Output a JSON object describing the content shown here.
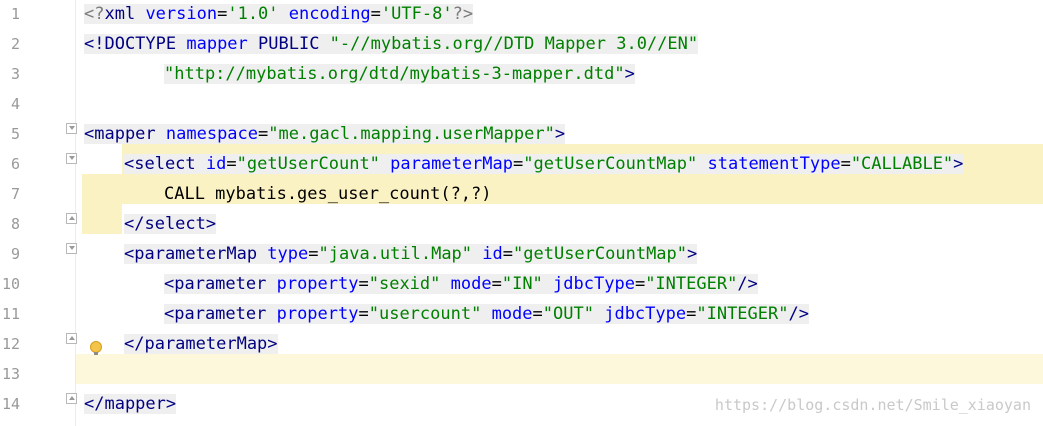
{
  "editor": {
    "lines": [
      {
        "num": "1",
        "segments": [
          {
            "t": "dim",
            "v": "<?"
          },
          {
            "t": "tag",
            "v": "xml "
          },
          {
            "t": "attr",
            "v": "version"
          },
          {
            "t": "txt",
            "v": "="
          },
          {
            "t": "val",
            "v": "'1.0'"
          },
          {
            "t": "txt",
            "v": " "
          },
          {
            "t": "attr",
            "v": "encoding"
          },
          {
            "t": "txt",
            "v": "="
          },
          {
            "t": "val",
            "v": "'UTF-8'"
          },
          {
            "t": "dim",
            "v": "?>"
          }
        ]
      },
      {
        "num": "2",
        "segments": [
          {
            "t": "tag",
            "v": "<!DOCTYPE "
          },
          {
            "t": "attr",
            "v": "mapper"
          },
          {
            "t": "tag",
            "v": " PUBLIC "
          },
          {
            "t": "val",
            "v": "\"-//mybatis.org//DTD Mapper 3.0//EN\""
          }
        ]
      },
      {
        "num": "3",
        "segments": [
          {
            "t": "val",
            "v": "\"http://mybatis.org/dtd/mybatis-3-mapper.dtd\""
          },
          {
            "t": "tag",
            "v": ">"
          }
        ]
      },
      {
        "num": "4",
        "segments": []
      },
      {
        "num": "5",
        "segments": [
          {
            "t": "tag",
            "v": "<mapper "
          },
          {
            "t": "attr",
            "v": "namespace"
          },
          {
            "t": "txt",
            "v": "="
          },
          {
            "t": "val",
            "v": "\"me.gacl.mapping.userMapper\""
          },
          {
            "t": "tag",
            "v": ">"
          }
        ]
      },
      {
        "num": "6",
        "segments": [
          {
            "t": "tag",
            "v": "<select "
          },
          {
            "t": "attr",
            "v": "id"
          },
          {
            "t": "txt",
            "v": "="
          },
          {
            "t": "val",
            "v": "\"getUserCount\""
          },
          {
            "t": "txt",
            "v": " "
          },
          {
            "t": "attr",
            "v": "parameterMap"
          },
          {
            "t": "txt",
            "v": "="
          },
          {
            "t": "val",
            "v": "\"getUserCountMap\""
          },
          {
            "t": "txt",
            "v": " "
          },
          {
            "t": "attr",
            "v": "statementType"
          },
          {
            "t": "txt",
            "v": "="
          },
          {
            "t": "val",
            "v": "\"CALLABLE\""
          },
          {
            "t": "tag",
            "v": ">"
          }
        ]
      },
      {
        "num": "7",
        "segments": [
          {
            "t": "txt",
            "v": "CALL mybatis.ges_user_count(?,?)"
          }
        ]
      },
      {
        "num": "8",
        "segments": [
          {
            "t": "tag",
            "v": "</select>"
          }
        ]
      },
      {
        "num": "9",
        "segments": [
          {
            "t": "tag",
            "v": "<parameterMap "
          },
          {
            "t": "attr",
            "v": "type"
          },
          {
            "t": "txt",
            "v": "="
          },
          {
            "t": "val",
            "v": "\"java.util.Map\""
          },
          {
            "t": "txt",
            "v": " "
          },
          {
            "t": "attr",
            "v": "id"
          },
          {
            "t": "txt",
            "v": "="
          },
          {
            "t": "val",
            "v": "\"getUserCountMap\""
          },
          {
            "t": "tag",
            "v": ">"
          }
        ]
      },
      {
        "num": "10",
        "segments": [
          {
            "t": "tag",
            "v": "<parameter "
          },
          {
            "t": "attr",
            "v": "property"
          },
          {
            "t": "txt",
            "v": "="
          },
          {
            "t": "val",
            "v": "\"sexid\""
          },
          {
            "t": "txt",
            "v": " "
          },
          {
            "t": "attr",
            "v": "mode"
          },
          {
            "t": "txt",
            "v": "="
          },
          {
            "t": "val",
            "v": "\"IN\""
          },
          {
            "t": "txt",
            "v": " "
          },
          {
            "t": "attr",
            "v": "jdbcType"
          },
          {
            "t": "txt",
            "v": "="
          },
          {
            "t": "val",
            "v": "\"INTEGER\""
          },
          {
            "t": "tag",
            "v": "/>"
          }
        ]
      },
      {
        "num": "11",
        "segments": [
          {
            "t": "tag",
            "v": "<parameter "
          },
          {
            "t": "attr",
            "v": "property"
          },
          {
            "t": "txt",
            "v": "="
          },
          {
            "t": "val",
            "v": "\"usercount\""
          },
          {
            "t": "txt",
            "v": " "
          },
          {
            "t": "attr",
            "v": "mode"
          },
          {
            "t": "txt",
            "v": "="
          },
          {
            "t": "val",
            "v": "\"OUT\""
          },
          {
            "t": "txt",
            "v": " "
          },
          {
            "t": "attr",
            "v": "jdbcType"
          },
          {
            "t": "txt",
            "v": "="
          },
          {
            "t": "val",
            "v": "\"INTEGER\""
          },
          {
            "t": "tag",
            "v": "/>"
          }
        ]
      },
      {
        "num": "12",
        "segments": [
          {
            "t": "tag",
            "v": "</parameterMap>"
          }
        ]
      },
      {
        "num": "13",
        "segments": []
      },
      {
        "num": "14",
        "segments": [
          {
            "t": "tag",
            "v": "</mapper>"
          }
        ]
      }
    ]
  },
  "watermark": "https://blog.csdn.net/Smile_xiaoyan",
  "colors": {
    "tag": "#000080",
    "attr": "#0000ff",
    "value": "#008000",
    "caret_line": "#fdf8dc",
    "block_highlight": "#fbf2c4"
  },
  "icons": {
    "fold_open": "fold-open-icon",
    "fold_close": "fold-close-icon",
    "intention": "lightbulb-icon"
  }
}
